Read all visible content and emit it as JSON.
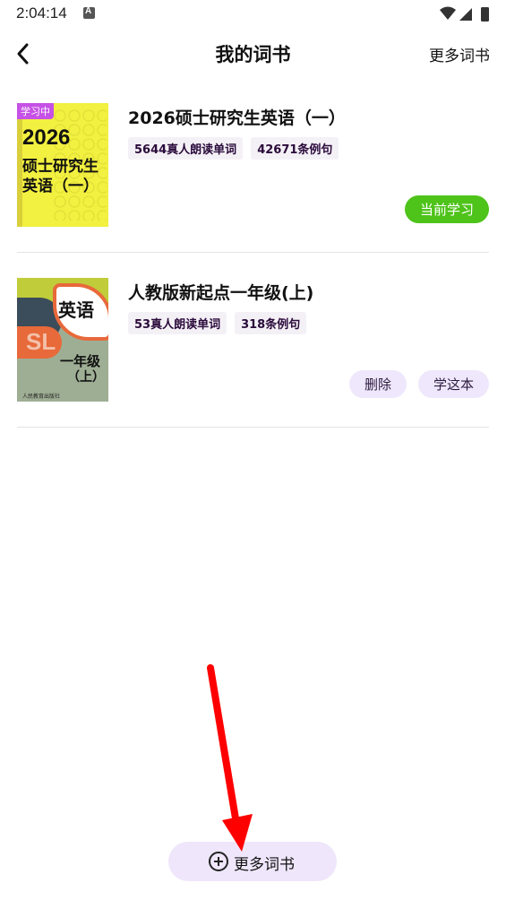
{
  "status": {
    "time": "2:04:14"
  },
  "header": {
    "title": "我的词书",
    "more_books": "更多词书"
  },
  "books": [
    {
      "title": "2026硕士研究生英语（一）",
      "tags": [
        "5644真人朗读单词",
        "42671条例句"
      ],
      "cover": {
        "badge": "学习中",
        "year": "2026",
        "line1": "硕士研究生",
        "line2": "英语（一）"
      },
      "button": "当前学习"
    },
    {
      "title": "人教版新起点一年级(上)",
      "tags": [
        "53真人朗读单词",
        "318条例句"
      ],
      "cover": {
        "subject": "英语",
        "logo": "SL",
        "grade1": "一年级",
        "grade2": "（上）",
        "publisher": "人民教育出版社"
      },
      "buttons": [
        "删除",
        "学这本"
      ]
    }
  ],
  "footer": {
    "more_books": "更多词书"
  },
  "colors": {
    "accent_green": "#4ec31a",
    "light_purple": "#efe7fb",
    "badge": "#c651e6",
    "arrow": "#ff0000"
  }
}
